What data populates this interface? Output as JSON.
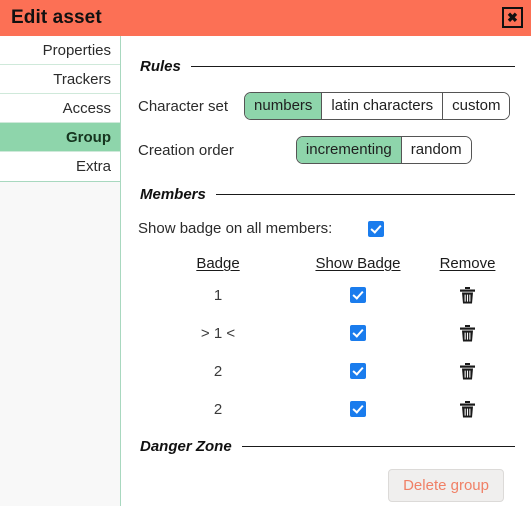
{
  "titlebar": {
    "title": "Edit asset",
    "close_label": "✖"
  },
  "sidebar": {
    "items": [
      {
        "label": "Properties",
        "selected": false
      },
      {
        "label": "Trackers",
        "selected": false
      },
      {
        "label": "Access",
        "selected": false
      },
      {
        "label": "Group",
        "selected": true
      },
      {
        "label": "Extra",
        "selected": false
      }
    ]
  },
  "rules": {
    "heading": "Rules",
    "character_set": {
      "label": "Character set",
      "options": [
        "numbers",
        "latin characters",
        "custom"
      ],
      "selected": "numbers"
    },
    "creation_order": {
      "label": "Creation order",
      "options": [
        "incrementing",
        "random"
      ],
      "selected": "incrementing"
    }
  },
  "members": {
    "heading": "Members",
    "show_badge_all": {
      "label": "Show badge on all members:",
      "checked": true
    },
    "columns": [
      "Badge",
      "Show Badge",
      "Remove"
    ],
    "rows": [
      {
        "badge": "1",
        "show_badge": true
      },
      {
        "badge": "> 1 <",
        "show_badge": true
      },
      {
        "badge": "2",
        "show_badge": true
      },
      {
        "badge": "2",
        "show_badge": true
      }
    ]
  },
  "danger_zone": {
    "heading": "Danger Zone",
    "delete_button": "Delete group"
  },
  "colors": {
    "titlebar": "#fc7055",
    "accent_green": "#8ed5ab",
    "checkbox_blue": "#1a7ced",
    "delete_text": "#f08066"
  }
}
